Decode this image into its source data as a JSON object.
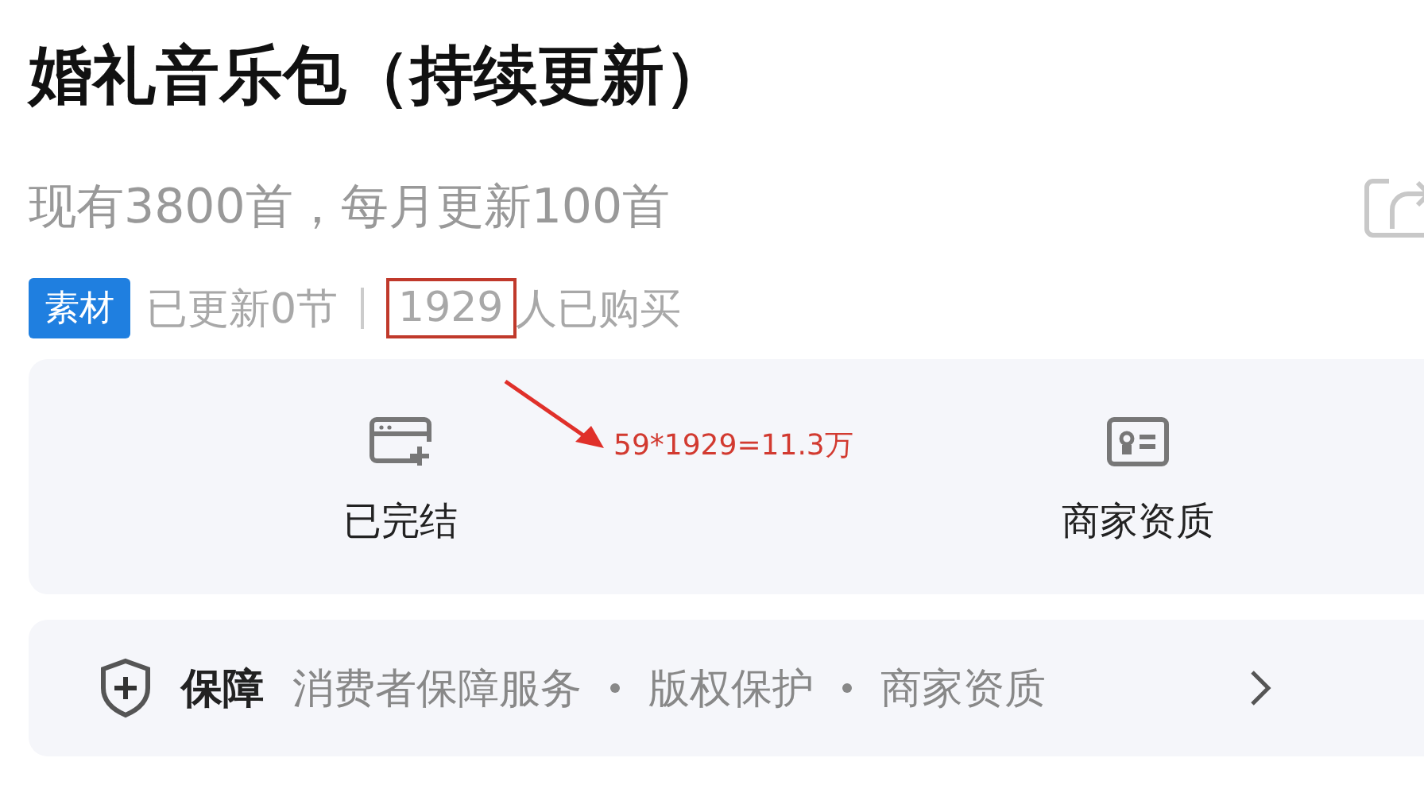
{
  "title": "婚礼音乐包（持续更新）",
  "subtitle": "现有3800首，每月更新100首",
  "meta": {
    "tag": "素材",
    "updated": "已更新0节",
    "purchase_count": "1929",
    "purchase_suffix": "人已购买",
    "count_highlighted": true
  },
  "annotation": {
    "text": "59*1929=11.3万"
  },
  "info_items": [
    {
      "kind": "finished",
      "label": "已完结"
    },
    {
      "kind": "merchant",
      "label": "商家资质"
    }
  ],
  "guarantee": {
    "title": "保障",
    "items": [
      "消费者保障服务",
      "版权保护",
      "商家资质"
    ]
  }
}
